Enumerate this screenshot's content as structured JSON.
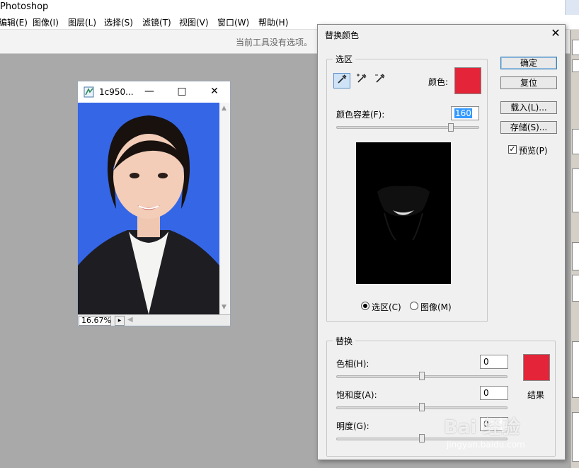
{
  "app": {
    "title": "Photoshop"
  },
  "menu": [
    "编辑(E)",
    "图像(I)",
    "图层(L)",
    "选择(S)",
    "滤镜(T)",
    "视图(V)",
    "窗口(W)",
    "帮助(H)"
  ],
  "options_bar": {
    "hint": "当前工具没有选项。"
  },
  "document": {
    "name": "1c950...",
    "zoom": "16.67%",
    "background_color": "#3566e6"
  },
  "dialog": {
    "title": "替换颜色",
    "selection_group": {
      "legend": "选区",
      "color_label": "颜色:",
      "selection_color": "#e42539",
      "fuzziness_label": "颜色容差(F):",
      "fuzziness_value": "160",
      "fuzziness_level": 0.8,
      "radio_selection": "选区(C)",
      "radio_image": "图像(M)",
      "selected_view": "选区(C)"
    },
    "buttons": {
      "ok": "确定",
      "reset": "复位",
      "load": "载入(L)...",
      "save": "存储(S)..."
    },
    "preview": {
      "label": "预览(P)",
      "checked": true
    },
    "replacement_group": {
      "legend": "替换",
      "hue_label": "色相(H):",
      "hue_value": "0",
      "saturation_label": "饱和度(A):",
      "saturation_value": "0",
      "lightness_label": "明度(G):",
      "lightness_value": "0",
      "result_label": "结果",
      "result_color": "#e42539"
    }
  },
  "watermark": {
    "main": "Bai 经验",
    "sub": "jingyan.baidu.com"
  }
}
